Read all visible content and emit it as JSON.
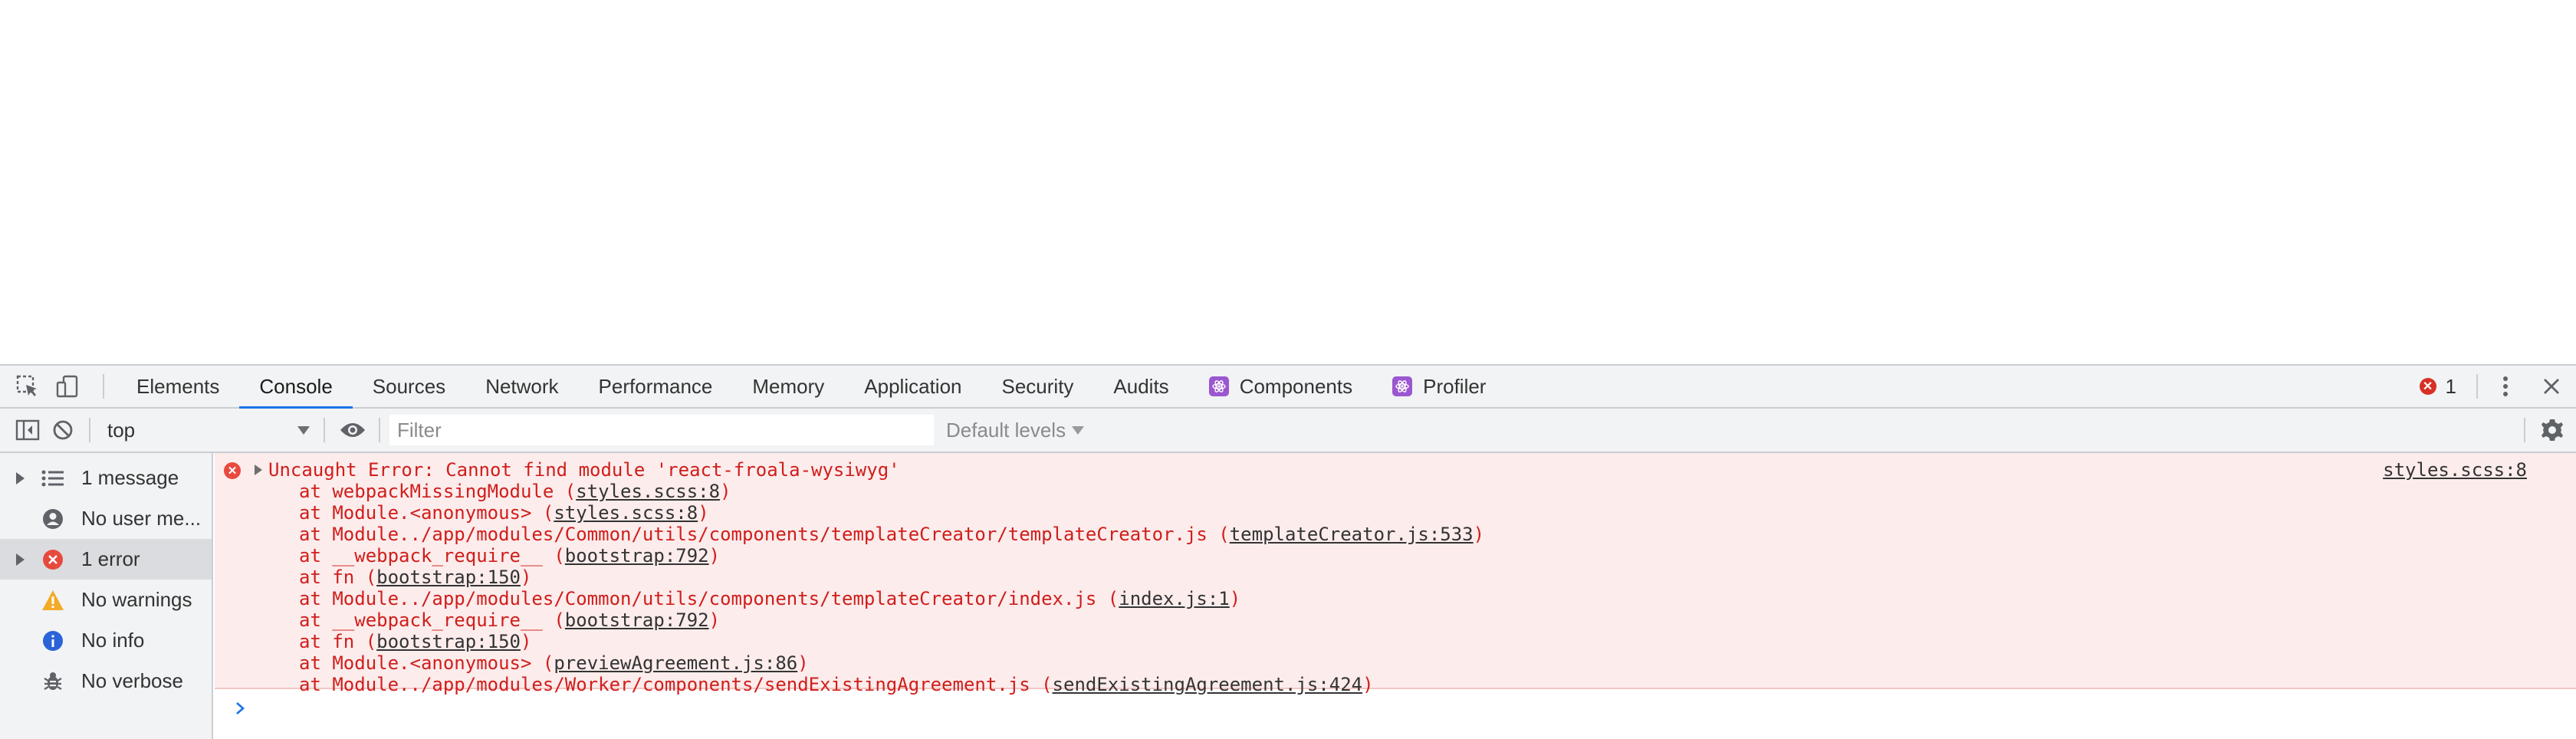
{
  "tabs": [
    {
      "label": "Elements",
      "active": false,
      "react": false
    },
    {
      "label": "Console",
      "active": true,
      "react": false
    },
    {
      "label": "Sources",
      "active": false,
      "react": false
    },
    {
      "label": "Network",
      "active": false,
      "react": false
    },
    {
      "label": "Performance",
      "active": false,
      "react": false
    },
    {
      "label": "Memory",
      "active": false,
      "react": false
    },
    {
      "label": "Application",
      "active": false,
      "react": false
    },
    {
      "label": "Security",
      "active": false,
      "react": false
    },
    {
      "label": "Audits",
      "active": false,
      "react": false
    },
    {
      "label": "Components",
      "active": false,
      "react": true
    },
    {
      "label": "Profiler",
      "active": false,
      "react": true
    }
  ],
  "error_badge": {
    "count": "1"
  },
  "toolbar": {
    "context": "top",
    "filter_placeholder": "Filter",
    "levels_label": "Default levels"
  },
  "sidebar": [
    {
      "label": "1 message",
      "icon": "list-icon",
      "expandable": true,
      "selected": false
    },
    {
      "label": "No user me...",
      "icon": "user-icon",
      "expandable": false,
      "selected": false
    },
    {
      "label": "1 error",
      "icon": "error-icon",
      "expandable": true,
      "selected": true
    },
    {
      "label": "No warnings",
      "icon": "warning-icon",
      "expandable": false,
      "selected": false
    },
    {
      "label": "No info",
      "icon": "info-icon",
      "expandable": false,
      "selected": false
    },
    {
      "label": "No verbose",
      "icon": "bug-icon",
      "expandable": false,
      "selected": false
    }
  ],
  "error": {
    "message": "Uncaught Error: Cannot find module 'react-froala-wysiwyg'",
    "source": "styles.scss:8",
    "stack": [
      {
        "text": "at webpackMissingModule (",
        "loc": "styles.scss:8",
        "end": ")"
      },
      {
        "text": "at Module.<anonymous> (",
        "loc": "styles.scss:8",
        "end": ")"
      },
      {
        "text": "at Module../app/modules/Common/utils/components/templateCreator/templateCreator.js (",
        "loc": "templateCreator.js:533",
        "end": ")"
      },
      {
        "text": "at __webpack_require__ (",
        "loc": "bootstrap:792",
        "end": ")"
      },
      {
        "text": "at fn (",
        "loc": "bootstrap:150",
        "end": ")"
      },
      {
        "text": "at Module../app/modules/Common/utils/components/templateCreator/index.js (",
        "loc": "index.js:1",
        "end": ")"
      },
      {
        "text": "at __webpack_require__ (",
        "loc": "bootstrap:792",
        "end": ")"
      },
      {
        "text": "at fn (",
        "loc": "bootstrap:150",
        "end": ")"
      },
      {
        "text": "at Module.<anonymous> (",
        "loc": "previewAgreement.js:86",
        "end": ")"
      },
      {
        "text": "at Module../app/modules/Worker/components/sendExistingAgreement.js (",
        "loc": "sendExistingAgreement.js:424",
        "end": ")"
      }
    ]
  },
  "colors": {
    "error_text": "#d01e1b",
    "error_bg": "#fcecec",
    "accent": "#1a73e8",
    "react_icon": "#9b57cf"
  }
}
